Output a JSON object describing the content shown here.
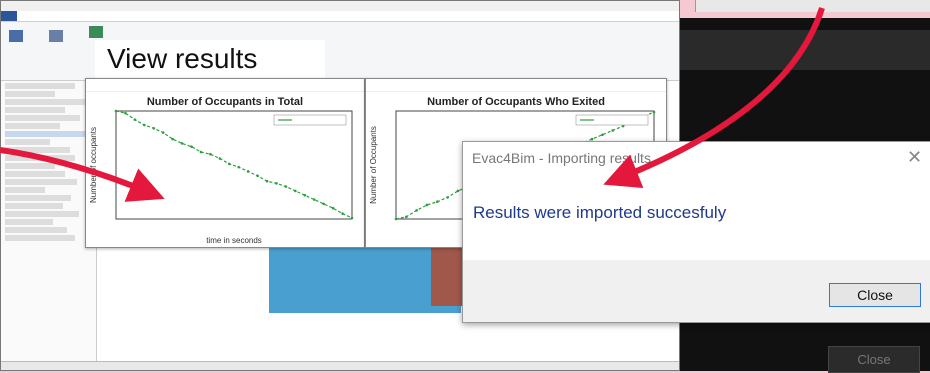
{
  "dialog": {
    "title": "Evac4Bim - Importing results",
    "message": "Results were imported succesfuly",
    "close_label": "Close",
    "close_icon": "close-icon"
  },
  "callout": {
    "label": "View results"
  },
  "background_panel": {
    "close_label": "Close"
  },
  "charts": {
    "total": {
      "title": "Number of Occupants in Total",
      "ylabel": "Number of occupants",
      "xlabel": "time in seconds"
    },
    "exited": {
      "title": "Number of Occupants Who Exited",
      "ylabel": "Number of Occupants"
    }
  },
  "chart_data": [
    {
      "type": "line",
      "title": "Number of Occupants in Total",
      "xlabel": "time in seconds",
      "ylabel": "Number of occupants",
      "series": [
        {
          "x": [
            0,
            2,
            4,
            6,
            8,
            10,
            12,
            14,
            16,
            18,
            20,
            22,
            24,
            26,
            28,
            30,
            32,
            34,
            36,
            38,
            40,
            42,
            44,
            46,
            48,
            50
          ],
          "values": [
            100,
            98,
            92,
            87,
            84,
            80,
            74,
            70,
            67,
            62,
            60,
            56,
            51,
            48,
            44,
            40,
            35,
            33,
            30,
            26,
            22,
            18,
            14,
            10,
            5,
            1
          ]
        }
      ]
    },
    {
      "type": "line",
      "title": "Number of Occupants Who Exited",
      "ylabel": "Number of Occupants",
      "series": [
        {
          "x": [
            0,
            2,
            4,
            6,
            8,
            10,
            12,
            14,
            16,
            18,
            20,
            22,
            24,
            26,
            28,
            30,
            32,
            34,
            36,
            38,
            40,
            42,
            44,
            46,
            48,
            50
          ],
          "values": [
            0,
            2,
            8,
            13,
            16,
            20,
            26,
            30,
            33,
            38,
            40,
            44,
            49,
            52,
            56,
            60,
            65,
            67,
            70,
            74,
            78,
            82,
            86,
            90,
            95,
            99
          ]
        }
      ]
    }
  ],
  "colors": {
    "background": "#f4c9d2",
    "arrow": "#e3183c",
    "line": "#2e9e3e",
    "message": "#1e3a8a"
  }
}
